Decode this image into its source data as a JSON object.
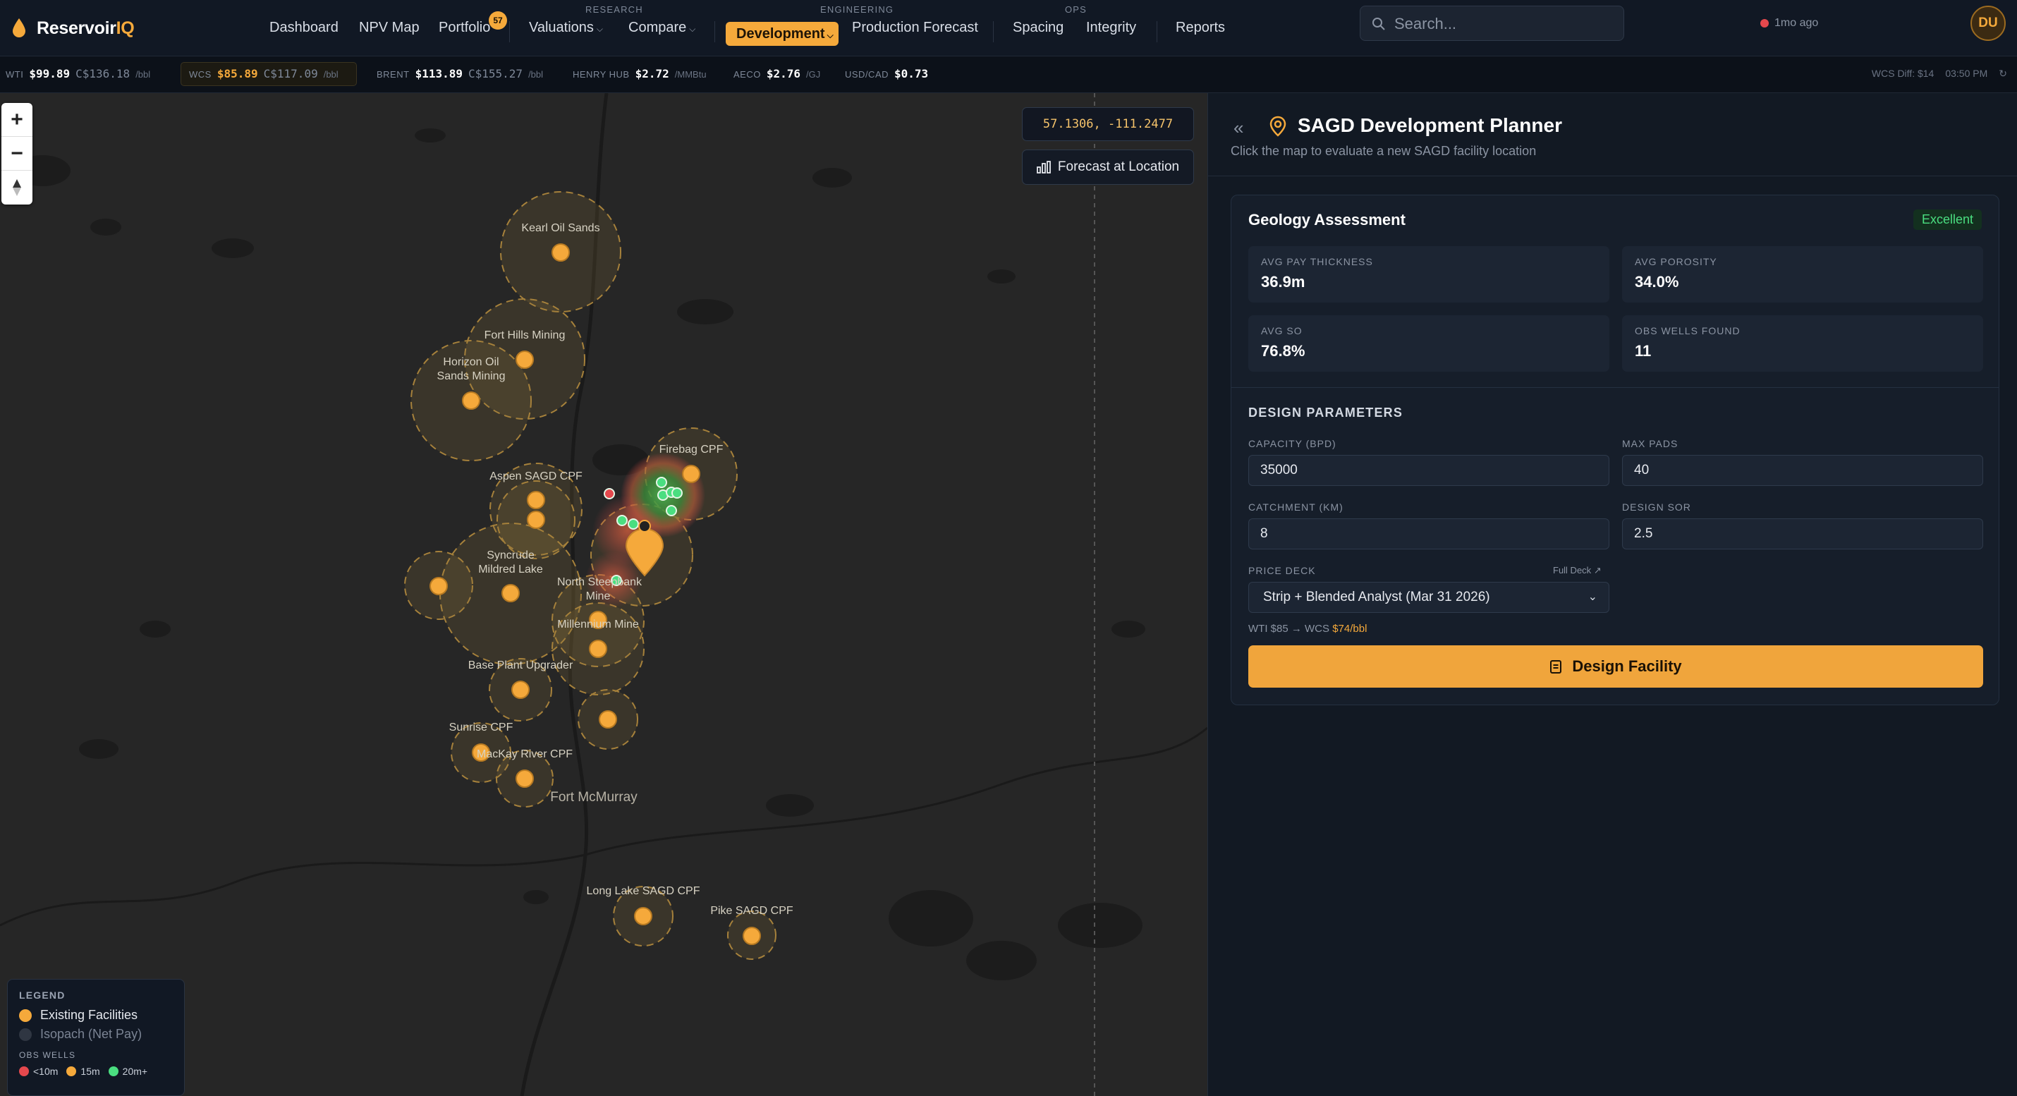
{
  "brand": {
    "name_main": "Reservoir",
    "name_accent": "IQ"
  },
  "nav": {
    "dashboard": "Dashboard",
    "npv_map": "NPV Map",
    "portfolio": "Portfolio",
    "portfolio_badge": "57",
    "research_label": "RESEARCH",
    "valuations": "Valuations",
    "compare": "Compare",
    "engineering_label": "ENGINEERING",
    "development": "Development",
    "production_forecast": "Production Forecast",
    "ops_label": "OPS",
    "spacing": "Spacing",
    "integrity": "Integrity",
    "reports": "Reports"
  },
  "search": {
    "placeholder": "Search..."
  },
  "status": {
    "text": "1mo ago",
    "color": "#e5484d"
  },
  "user": {
    "initials": "DU"
  },
  "ticker": {
    "wti": {
      "label": "WTI",
      "value": "$99.89",
      "cad": "C$136.18",
      "unit": "/bbl"
    },
    "wcs": {
      "label": "WCS",
      "value": "$85.89",
      "cad": "C$117.09",
      "unit": "/bbl"
    },
    "brent": {
      "label": "BRENT",
      "value": "$113.89",
      "cad": "C$155.27",
      "unit": "/bbl"
    },
    "henry_hub": {
      "label": "HENRY HUB",
      "value": "$2.72",
      "unit": "/MMBtu"
    },
    "aeco": {
      "label": "AECO",
      "value": "$2.76",
      "unit": "/GJ"
    },
    "usdcad": {
      "label": "USD/CAD",
      "value": "$0.73"
    },
    "wcs_diff": "WCS Diff: $14",
    "time": "03:50 PM"
  },
  "map": {
    "coordinates": "57.1306, -111.2477",
    "forecast_button": "Forecast at Location",
    "labels": {
      "kearl": "Kearl Oil Sands",
      "fort_hills": "Fort Hills Mining",
      "horizon_1": "Horizon Oil",
      "horizon_2": "Sands Mining",
      "aspen": "Aspen SAGD CPF",
      "firebag": "Firebag CPF",
      "syncrude_1": "Syncrude",
      "syncrude_2": "Mildred Lake",
      "north_steepbank_1": "North Steepbank",
      "north_steepbank_2": "Mine",
      "millennium": "Millennium Mine",
      "base_plant": "Base Plant Upgrader",
      "sunrise": "Sunrise CPF",
      "mackay": "MacKay River CPF",
      "fort_mcmurray": "Fort McMurray",
      "long_lake": "Long Lake SAGD CPF",
      "pike": "Pike SAGD CPF"
    },
    "legend": {
      "title": "LEGEND",
      "existing": "Existing Facilities",
      "isopach": "Isopach (Net Pay)",
      "obs_wells_title": "OBS WELLS",
      "lt10": "<10m",
      "m15": "15m",
      "m20": "20m+"
    },
    "colors": {
      "facility": "#f5a93b",
      "well_low": "#e5484d",
      "well_mid": "#f5a93b",
      "well_high": "#4ade80"
    }
  },
  "panel": {
    "title": "SAGD Development Planner",
    "subtitle": "Click the map to evaluate a new SAGD facility location",
    "geology": {
      "title": "Geology Assessment",
      "rating": "Excellent",
      "avg_pay_label": "AVG PAY THICKNESS",
      "avg_pay": "36.9m",
      "avg_porosity_label": "AVG POROSITY",
      "avg_porosity": "34.0%",
      "avg_so_label": "AVG SO",
      "avg_so": "76.8%",
      "obs_wells_label": "OBS WELLS FOUND",
      "obs_wells": "11"
    },
    "design": {
      "title": "DESIGN PARAMETERS",
      "capacity_label": "CAPACITY (BPD)",
      "capacity": "35000",
      "max_pads_label": "MAX PADS",
      "max_pads": "40",
      "catchment_label": "CATCHMENT (KM)",
      "catchment": "8",
      "sor_label": "DESIGN SOR",
      "sor": "2.5",
      "price_deck_label": "PRICE DECK",
      "full_deck": "Full Deck",
      "price_deck": "Strip + Blended Analyst (Mar 31 2026)",
      "price_note_prefix": "WTI $85 → WCS",
      "price_note_value": "$74/bbl",
      "button": "Design Facility"
    }
  }
}
